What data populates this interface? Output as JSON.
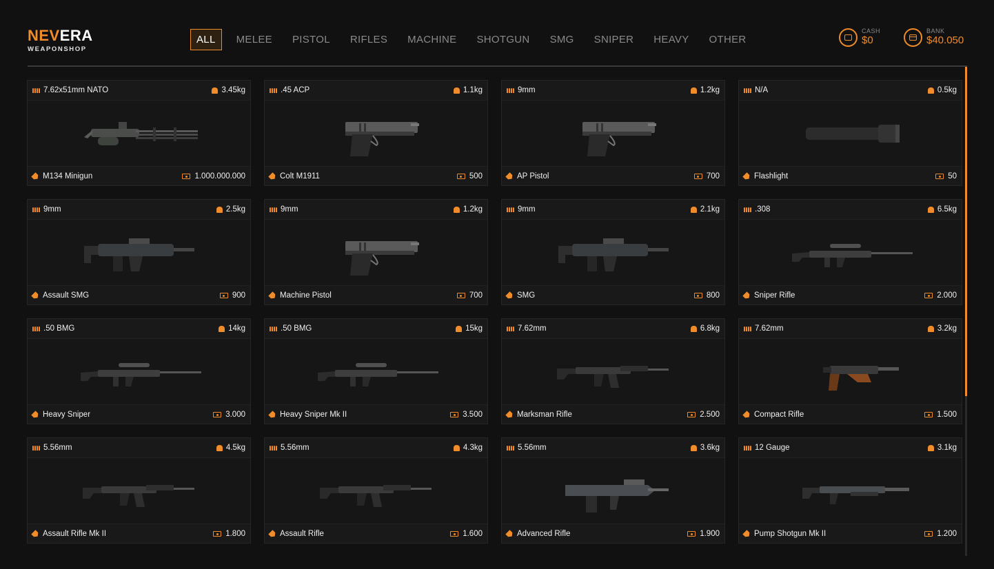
{
  "brand": {
    "accent": "NEV",
    "rest": "ERA",
    "subtitle": "WEAPONSHOP"
  },
  "tabs": [
    {
      "label": "ALL",
      "active": true
    },
    {
      "label": "MELEE"
    },
    {
      "label": "PISTOL"
    },
    {
      "label": "RIFLES"
    },
    {
      "label": "MACHINE"
    },
    {
      "label": "SHOTGUN"
    },
    {
      "label": "SMG"
    },
    {
      "label": "SNIPER"
    },
    {
      "label": "HEAVY"
    },
    {
      "label": "OTHER"
    }
  ],
  "wallet": {
    "cash": {
      "label": "CASH",
      "amount": "$0"
    },
    "bank": {
      "label": "BANK",
      "amount": "$40.050"
    }
  },
  "items": [
    {
      "ammo": "7.62x51mm NATO",
      "weight": "3.45kg",
      "name": "M134 Minigun",
      "price": "1.000.000.000",
      "icon": "minigun"
    },
    {
      "ammo": ".45 ACP",
      "weight": "1.1kg",
      "name": "Colt M1911",
      "price": "500",
      "icon": "pistol"
    },
    {
      "ammo": "9mm",
      "weight": "1.2kg",
      "name": "AP Pistol",
      "price": "700",
      "icon": "pistol"
    },
    {
      "ammo": "N/A",
      "weight": "0.5kg",
      "name": "Flashlight",
      "price": "50",
      "icon": "flashlight"
    },
    {
      "ammo": "9mm",
      "weight": "2.5kg",
      "name": "Assault SMG",
      "price": "900",
      "icon": "smg"
    },
    {
      "ammo": "9mm",
      "weight": "1.2kg",
      "name": "Machine Pistol",
      "price": "700",
      "icon": "pistol"
    },
    {
      "ammo": "9mm",
      "weight": "2.1kg",
      "name": "SMG",
      "price": "800",
      "icon": "smg"
    },
    {
      "ammo": ".308",
      "weight": "6.5kg",
      "name": "Sniper Rifle",
      "price": "2.000",
      "icon": "sniper"
    },
    {
      "ammo": ".50 BMG",
      "weight": "14kg",
      "name": "Heavy Sniper",
      "price": "3.000",
      "icon": "sniper"
    },
    {
      "ammo": ".50 BMG",
      "weight": "15kg",
      "name": "Heavy Sniper Mk II",
      "price": "3.500",
      "icon": "sniper"
    },
    {
      "ammo": "7.62mm",
      "weight": "6.8kg",
      "name": "Marksman Rifle",
      "price": "2.500",
      "icon": "rifle"
    },
    {
      "ammo": "7.62mm",
      "weight": "3.2kg",
      "name": "Compact Rifle",
      "price": "1.500",
      "icon": "compact"
    },
    {
      "ammo": "5.56mm",
      "weight": "4.5kg",
      "name": "Assault Rifle Mk II",
      "price": "1.800",
      "icon": "rifle"
    },
    {
      "ammo": "5.56mm",
      "weight": "4.3kg",
      "name": "Assault Rifle",
      "price": "1.600",
      "icon": "rifle"
    },
    {
      "ammo": "5.56mm",
      "weight": "3.6kg",
      "name": "Advanced Rifle",
      "price": "1.900",
      "icon": "bullpup"
    },
    {
      "ammo": "12 Gauge",
      "weight": "3.1kg",
      "name": "Pump Shotgun Mk II",
      "price": "1.200",
      "icon": "shotgun"
    }
  ]
}
